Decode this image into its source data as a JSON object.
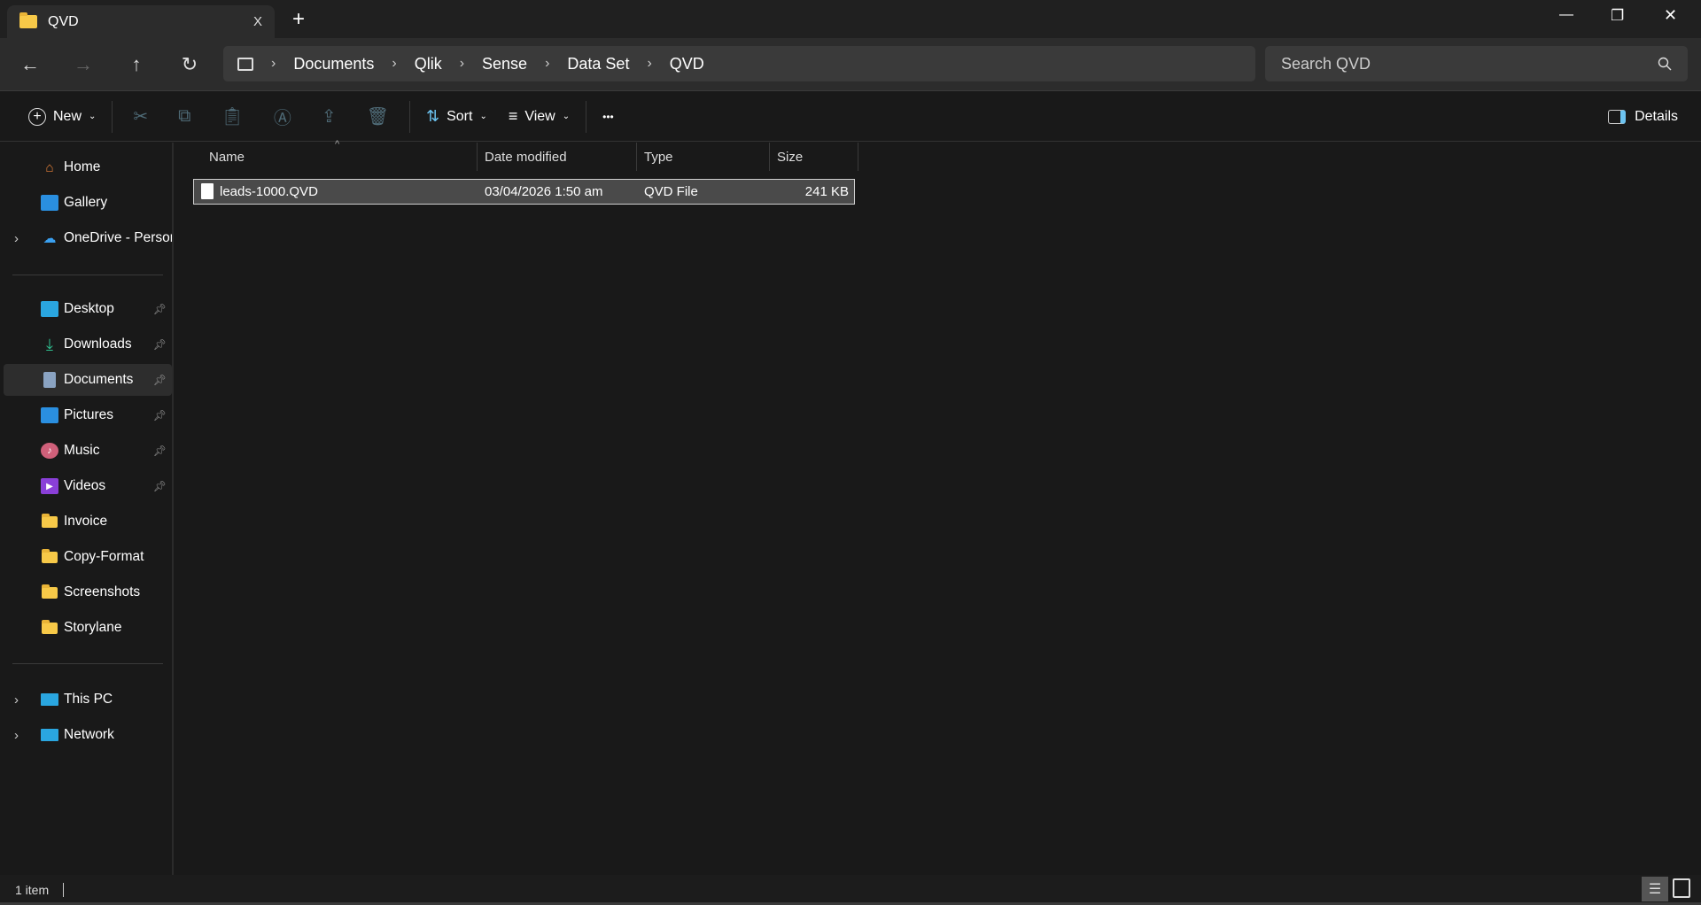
{
  "window": {
    "tab_title": "QVD",
    "new_tab": "+",
    "close_tab": "X",
    "minimize": "—",
    "maximize": "❐",
    "close": "✕"
  },
  "nav": {
    "back": "←",
    "forward": "→",
    "up": "↑",
    "refresh": "↻"
  },
  "breadcrumb": [
    "Documents",
    "Qlik",
    "Sense",
    "Data Set",
    "QVD"
  ],
  "search": {
    "placeholder": "Search QVD"
  },
  "toolbar": {
    "new": "New",
    "sort": "Sort",
    "view": "View",
    "more": "•••",
    "details": "Details"
  },
  "sidebar": {
    "top": [
      {
        "label": "Home"
      },
      {
        "label": "Gallery"
      },
      {
        "label": "OneDrive - Personal"
      }
    ],
    "pinned": [
      {
        "label": "Desktop"
      },
      {
        "label": "Downloads"
      },
      {
        "label": "Documents"
      },
      {
        "label": "Pictures"
      },
      {
        "label": "Music"
      },
      {
        "label": "Videos"
      }
    ],
    "folders": [
      {
        "label": "Invoice"
      },
      {
        "label": "Copy-Format"
      },
      {
        "label": "Screenshots"
      },
      {
        "label": "Storylane"
      }
    ],
    "bottom": [
      {
        "label": "This PC"
      },
      {
        "label": "Network"
      }
    ]
  },
  "columns": {
    "name": "Name",
    "date": "Date modified",
    "type": "Type",
    "size": "Size"
  },
  "files": [
    {
      "name": "leads-1000.QVD",
      "date": "03/04/2026 1:50 am",
      "type": "QVD File",
      "size": "241 KB"
    }
  ],
  "status": {
    "count": "1 item"
  }
}
